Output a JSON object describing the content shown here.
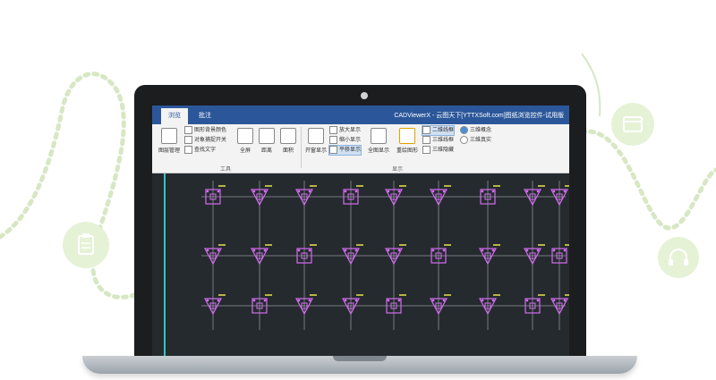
{
  "tabs": [
    {
      "label": "浏览",
      "active": true
    },
    {
      "label": "批注",
      "active": false
    }
  ],
  "app_title": "CADViewerX - 云图天下[YTTXSoft.com]图纸浏览控件-试用版",
  "ribbon": {
    "tools_group": {
      "label": "工具",
      "layer_manage": "图层管理",
      "bg_color": "图形背景颜色",
      "snap_toggle": "对象捕捉开关",
      "find_text": "查找文字",
      "fullscreen": "全屏",
      "distance": "距离",
      "area": "面积"
    },
    "display_group": {
      "label": "显示",
      "window_zoom": "开窗显示",
      "zoom_in": "放大显示",
      "zoom_out": "缩小显示",
      "pan": "平移显示",
      "zoom_extents": "全图显示",
      "redraw": "重绘图形",
      "wireframe_2d": "二维线框",
      "wireframe_3d": "三维线框",
      "hidden_3d": "三维隐藏",
      "concept_3d": "三维概念",
      "realistic_3d": "三维真实"
    }
  },
  "colors": {
    "accent": "#2b579a",
    "cad_bg": "#252a2f",
    "cad_shapes": "#d46cf0",
    "cad_labels": "#e8e24a",
    "cad_lines": "#c8cdd2",
    "cad_axis": "#34c6c2"
  }
}
